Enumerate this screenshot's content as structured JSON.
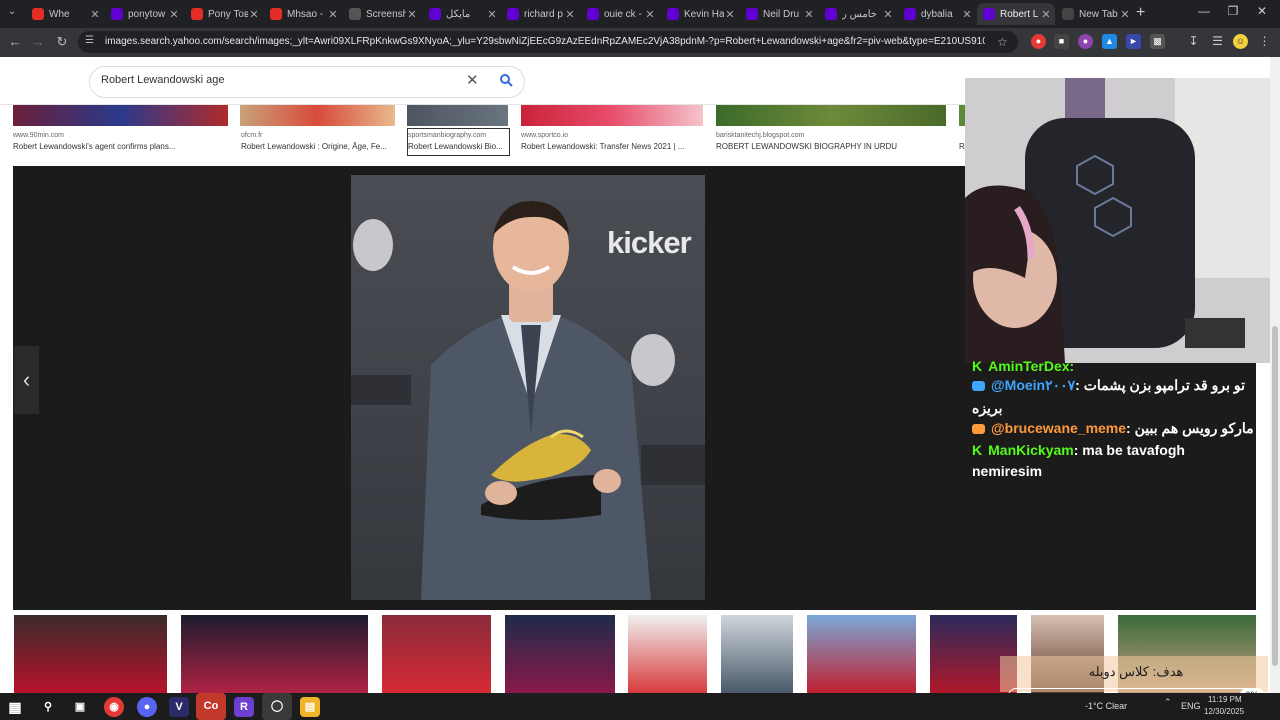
{
  "browser": {
    "tabs": [
      {
        "label": "Whe",
        "favicon": "youtube-icon",
        "color": "#e52d27",
        "active": false
      },
      {
        "label": "ponytow",
        "favicon": "yahoo-icon",
        "color": "#6001d2",
        "active": false
      },
      {
        "label": "Pony Toв",
        "favicon": "youtube-icon",
        "color": "#e52d27",
        "active": false
      },
      {
        "label": "Mhsao -",
        "favicon": "youtube-icon",
        "color": "#e52d27",
        "active": false
      },
      {
        "label": "Screensh",
        "favicon": "globe-icon",
        "color": "#555555",
        "active": false
      },
      {
        "label": "مایکل",
        "favicon": "yahoo-icon",
        "color": "#6001d2",
        "active": false
      },
      {
        "label": "richard p",
        "favicon": "yahoo-icon",
        "color": "#6001d2",
        "active": false
      },
      {
        "label": "ouie ck -",
        "favicon": "yahoo-icon",
        "color": "#6001d2",
        "active": false
      },
      {
        "label": "Kevin Ha",
        "favicon": "yahoo-icon",
        "color": "#6001d2",
        "active": false
      },
      {
        "label": "Neil Dru",
        "favicon": "yahoo-icon",
        "color": "#6001d2",
        "active": false
      },
      {
        "label": "خامس ر",
        "favicon": "yahoo-icon",
        "color": "#6001d2",
        "active": false
      },
      {
        "label": "dybalia",
        "favicon": "yahoo-icon",
        "color": "#6001d2",
        "active": false
      },
      {
        "label": "Robert L",
        "favicon": "yahoo-icon",
        "color": "#6001d2",
        "active": true
      },
      {
        "label": "New Tab",
        "favicon": "newtab-icon",
        "color": "#444444",
        "active": false
      }
    ],
    "url": "images.search.yahoo.com/search/images;_ylt=Awri09XLFRpKnkwGs9XNyoA;_ylu=Y29sbwNiZjEEcG9zAzEEdnRpZAMEc2VjA38pdnM-?p=Robert+Lewandowski+age&fr2=piv-web&type=E210US91082G0&fr=mcafee..."
  },
  "search": {
    "query": "Robert Lewandowski age"
  },
  "results": [
    {
      "source": "www.90min.com",
      "caption": "Robert Lewandowski's agent confirms plans..."
    },
    {
      "source": "ofcm.fr",
      "caption": "Robert Lewandowski : Origine, Âge, Fe..."
    },
    {
      "source": "sportsmanbiography.com",
      "caption": "Robert Lewandowski Bio..."
    },
    {
      "source": "www.sportco.io",
      "caption": "Robert Lewandowski: Transfer News 2021 | ..."
    },
    {
      "source": "barisktanitechj.blogspot.com",
      "caption": "ROBERT LEWANDOWSKI BIOGRAPHY IN URDU"
    },
    {
      "source": "",
      "caption": "R"
    }
  ],
  "viewer": {
    "photo_text": "kicker"
  },
  "chat": [
    {
      "user": "AminTerDex:",
      "message": "",
      "platform": "kick"
    },
    {
      "user": "@Moein۲۰۰۷",
      "message": ": تو برو قد ترامپو بزن پشمات",
      "extra": "بریزه",
      "platform": "youtube"
    },
    {
      "user": "@brucewane_meme",
      "message": ": مارکو رویس هم ببین",
      "platform": "youtube"
    },
    {
      "user": "ManKickyam",
      "message": ": ma be tavafogh",
      "extra": "nemiresim",
      "platform": "kick"
    }
  ],
  "goal": {
    "text": "هدف: کلاس دوبله",
    "percent": "0%",
    "progress": 0
  },
  "taskbar": {
    "weather": "-1°C  Clear",
    "lang": "ENG",
    "time": "11:19 PM",
    "date": "12/30/2025"
  }
}
